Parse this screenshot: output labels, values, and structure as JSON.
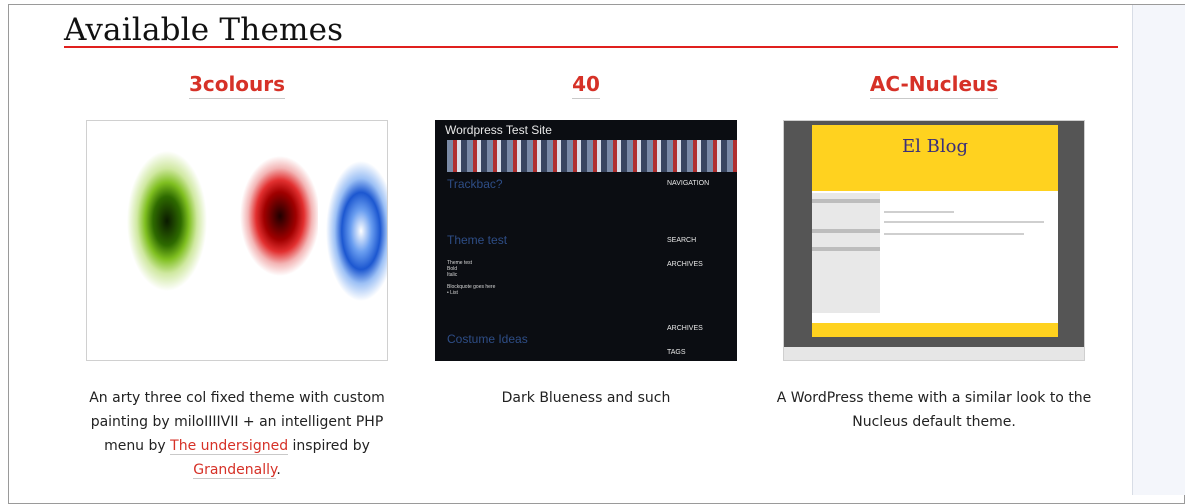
{
  "page": {
    "heading": "Available Themes",
    "accent": "#e0201e",
    "link_color": "#d63127"
  },
  "themes": [
    {
      "title": "3colours",
      "desc_parts": {
        "a": "An arty three col fixed theme with custom painting by miloIIIIVII + an intelligent PHP menu by ",
        "link1": "The undersigned",
        "b": " inspired by ",
        "link2": "Grandenally",
        "c": "."
      }
    },
    {
      "title": "40",
      "description": "Dark Blueness and such",
      "thumb": {
        "site_title": "Wordpress Test Site",
        "posts": [
          "Trackbac?",
          "Theme test",
          "Costume Ideas"
        ],
        "sidebar": [
          "NAVIGATION",
          "SEARCH",
          "ARCHIVES",
          "ARCHIVES",
          "TAGS"
        ]
      }
    },
    {
      "title": "AC-Nucleus",
      "description": "A WordPress theme with a similar look to the Nucleus default theme.",
      "thumb": {
        "blog_title": "El Blog"
      }
    }
  ]
}
